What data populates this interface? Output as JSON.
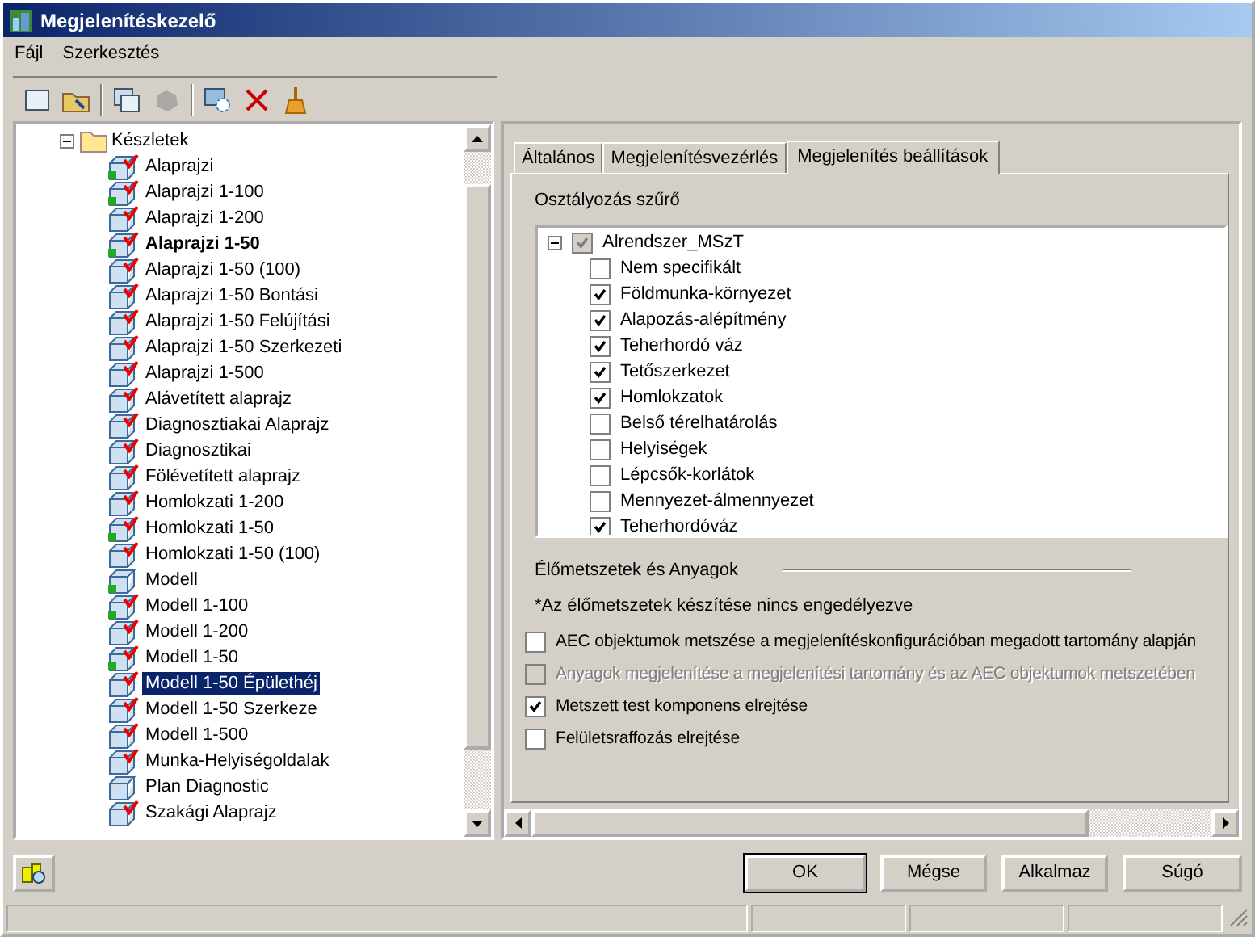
{
  "window": {
    "title": "Megjelenítéskezelő"
  },
  "menu": [
    "Fájl",
    "Szerkesztés"
  ],
  "toolbar": [
    {
      "kind": "page",
      "disabled": false
    },
    {
      "kind": "folder",
      "disabled": false
    },
    {
      "kind": "sep"
    },
    {
      "kind": "copy",
      "disabled": false
    },
    {
      "kind": "blob",
      "disabled": true
    },
    {
      "kind": "sep"
    },
    {
      "kind": "refresh",
      "disabled": false
    },
    {
      "kind": "delete",
      "disabled": false
    },
    {
      "kind": "broom",
      "disabled": false
    }
  ],
  "tree": {
    "label": "Készletek",
    "expanded": true,
    "children": [
      {
        "label": "Alaprajzi",
        "in_use": true,
        "checked": true,
        "current": false,
        "selected": false
      },
      {
        "label": "Alaprajzi 1-100",
        "in_use": true,
        "checked": true,
        "current": false,
        "selected": false
      },
      {
        "label": "Alaprajzi 1-200",
        "in_use": false,
        "checked": true,
        "current": false,
        "selected": false
      },
      {
        "label": "Alaprajzi 1-50",
        "in_use": true,
        "checked": true,
        "current": true,
        "selected": false
      },
      {
        "label": "Alaprajzi 1-50 (100)",
        "in_use": false,
        "checked": true,
        "current": false,
        "selected": false
      },
      {
        "label": "Alaprajzi 1-50 Bontási",
        "in_use": false,
        "checked": true,
        "current": false,
        "selected": false
      },
      {
        "label": "Alaprajzi 1-50 Felújítási",
        "in_use": false,
        "checked": true,
        "current": false,
        "selected": false
      },
      {
        "label": "Alaprajzi 1-50 Szerkezeti",
        "in_use": false,
        "checked": true,
        "current": false,
        "selected": false
      },
      {
        "label": "Alaprajzi 1-500",
        "in_use": false,
        "checked": true,
        "current": false,
        "selected": false
      },
      {
        "label": "Alávetített alaprajz",
        "in_use": false,
        "checked": true,
        "current": false,
        "selected": false
      },
      {
        "label": "Diagnosztiakai Alaprajz",
        "in_use": false,
        "checked": true,
        "current": false,
        "selected": false
      },
      {
        "label": "Diagnosztikai",
        "in_use": false,
        "checked": true,
        "current": false,
        "selected": false
      },
      {
        "label": "Fölévetített alaprajz",
        "in_use": false,
        "checked": true,
        "current": false,
        "selected": false
      },
      {
        "label": "Homlokzati 1-200",
        "in_use": false,
        "checked": true,
        "current": false,
        "selected": false
      },
      {
        "label": "Homlokzati 1-50",
        "in_use": true,
        "checked": true,
        "current": false,
        "selected": false
      },
      {
        "label": "Homlokzati 1-50 (100)",
        "in_use": false,
        "checked": true,
        "current": false,
        "selected": false
      },
      {
        "label": "Modell",
        "in_use": true,
        "checked": false,
        "current": false,
        "selected": false
      },
      {
        "label": "Modell 1-100",
        "in_use": true,
        "checked": true,
        "current": false,
        "selected": false
      },
      {
        "label": "Modell 1-200",
        "in_use": false,
        "checked": true,
        "current": false,
        "selected": false
      },
      {
        "label": "Modell 1-50",
        "in_use": true,
        "checked": true,
        "current": false,
        "selected": false
      },
      {
        "label": "Modell 1-50 Épülethéj",
        "in_use": false,
        "checked": true,
        "current": false,
        "selected": true
      },
      {
        "label": "Modell 1-50 Szerkeze",
        "in_use": false,
        "checked": true,
        "current": false,
        "selected": false
      },
      {
        "label": "Modell 1-500",
        "in_use": false,
        "checked": true,
        "current": false,
        "selected": false
      },
      {
        "label": "Munka-Helyiségoldalak",
        "in_use": false,
        "checked": true,
        "current": false,
        "selected": false
      },
      {
        "label": "Plan Diagnostic",
        "in_use": false,
        "checked": false,
        "current": false,
        "selected": false
      },
      {
        "label": "Szakági Alaprajz",
        "in_use": false,
        "checked": true,
        "current": false,
        "selected": false
      }
    ]
  },
  "tabs": [
    {
      "label": "Általános",
      "selected": false
    },
    {
      "label": "Megjelenítésvezérlés",
      "selected": false
    },
    {
      "label": "Megjelenítés beállítások",
      "selected": true
    }
  ],
  "filter": {
    "label": "Osztályozás szűrő",
    "root": {
      "label": "Alrendszer_MSzT",
      "checked": true,
      "disabled": true,
      "expanded": true,
      "children": [
        {
          "label": "Nem specifikált",
          "checked": false
        },
        {
          "label": "Földmunka-környezet",
          "checked": true
        },
        {
          "label": "Alapozás-alépítmény",
          "checked": true
        },
        {
          "label": "Teherhordó váz",
          "checked": true
        },
        {
          "label": "Tetőszerkezet",
          "checked": true
        },
        {
          "label": "Homlokzatok",
          "checked": true
        },
        {
          "label": "Belső térelhatárolás",
          "checked": false
        },
        {
          "label": "Helyiségek",
          "checked": false
        },
        {
          "label": "Lépcsők-korlátok",
          "checked": false
        },
        {
          "label": "Mennyezet-álmennyezet",
          "checked": false
        },
        {
          "label": "Teherhordóváz",
          "checked": true
        }
      ]
    }
  },
  "section": {
    "title": "Élőmetszetek és Anyagok",
    "note": "*Az élőmetszetek készítése nincs engedélyezve",
    "options": [
      {
        "label": "AEC objektumok metszése a megjelenítéskonfigurációban megadott tartomány alapján",
        "checked": false,
        "disabled": false
      },
      {
        "label": "Anyagok megjelenítése a megjelenítési tartomány és az AEC objektumok metszetében",
        "checked": false,
        "disabled": true
      },
      {
        "label": "Metszett test komponens elrejtése",
        "checked": true,
        "disabled": false
      },
      {
        "label": "Felületsraffozás elrejtése",
        "checked": false,
        "disabled": false
      }
    ]
  },
  "buttons": [
    {
      "label": "OK",
      "default": true
    },
    {
      "label": "Mégse",
      "default": false
    },
    {
      "label": "Alkalmaz",
      "default": false
    },
    {
      "label": "Súgó",
      "default": false
    }
  ]
}
